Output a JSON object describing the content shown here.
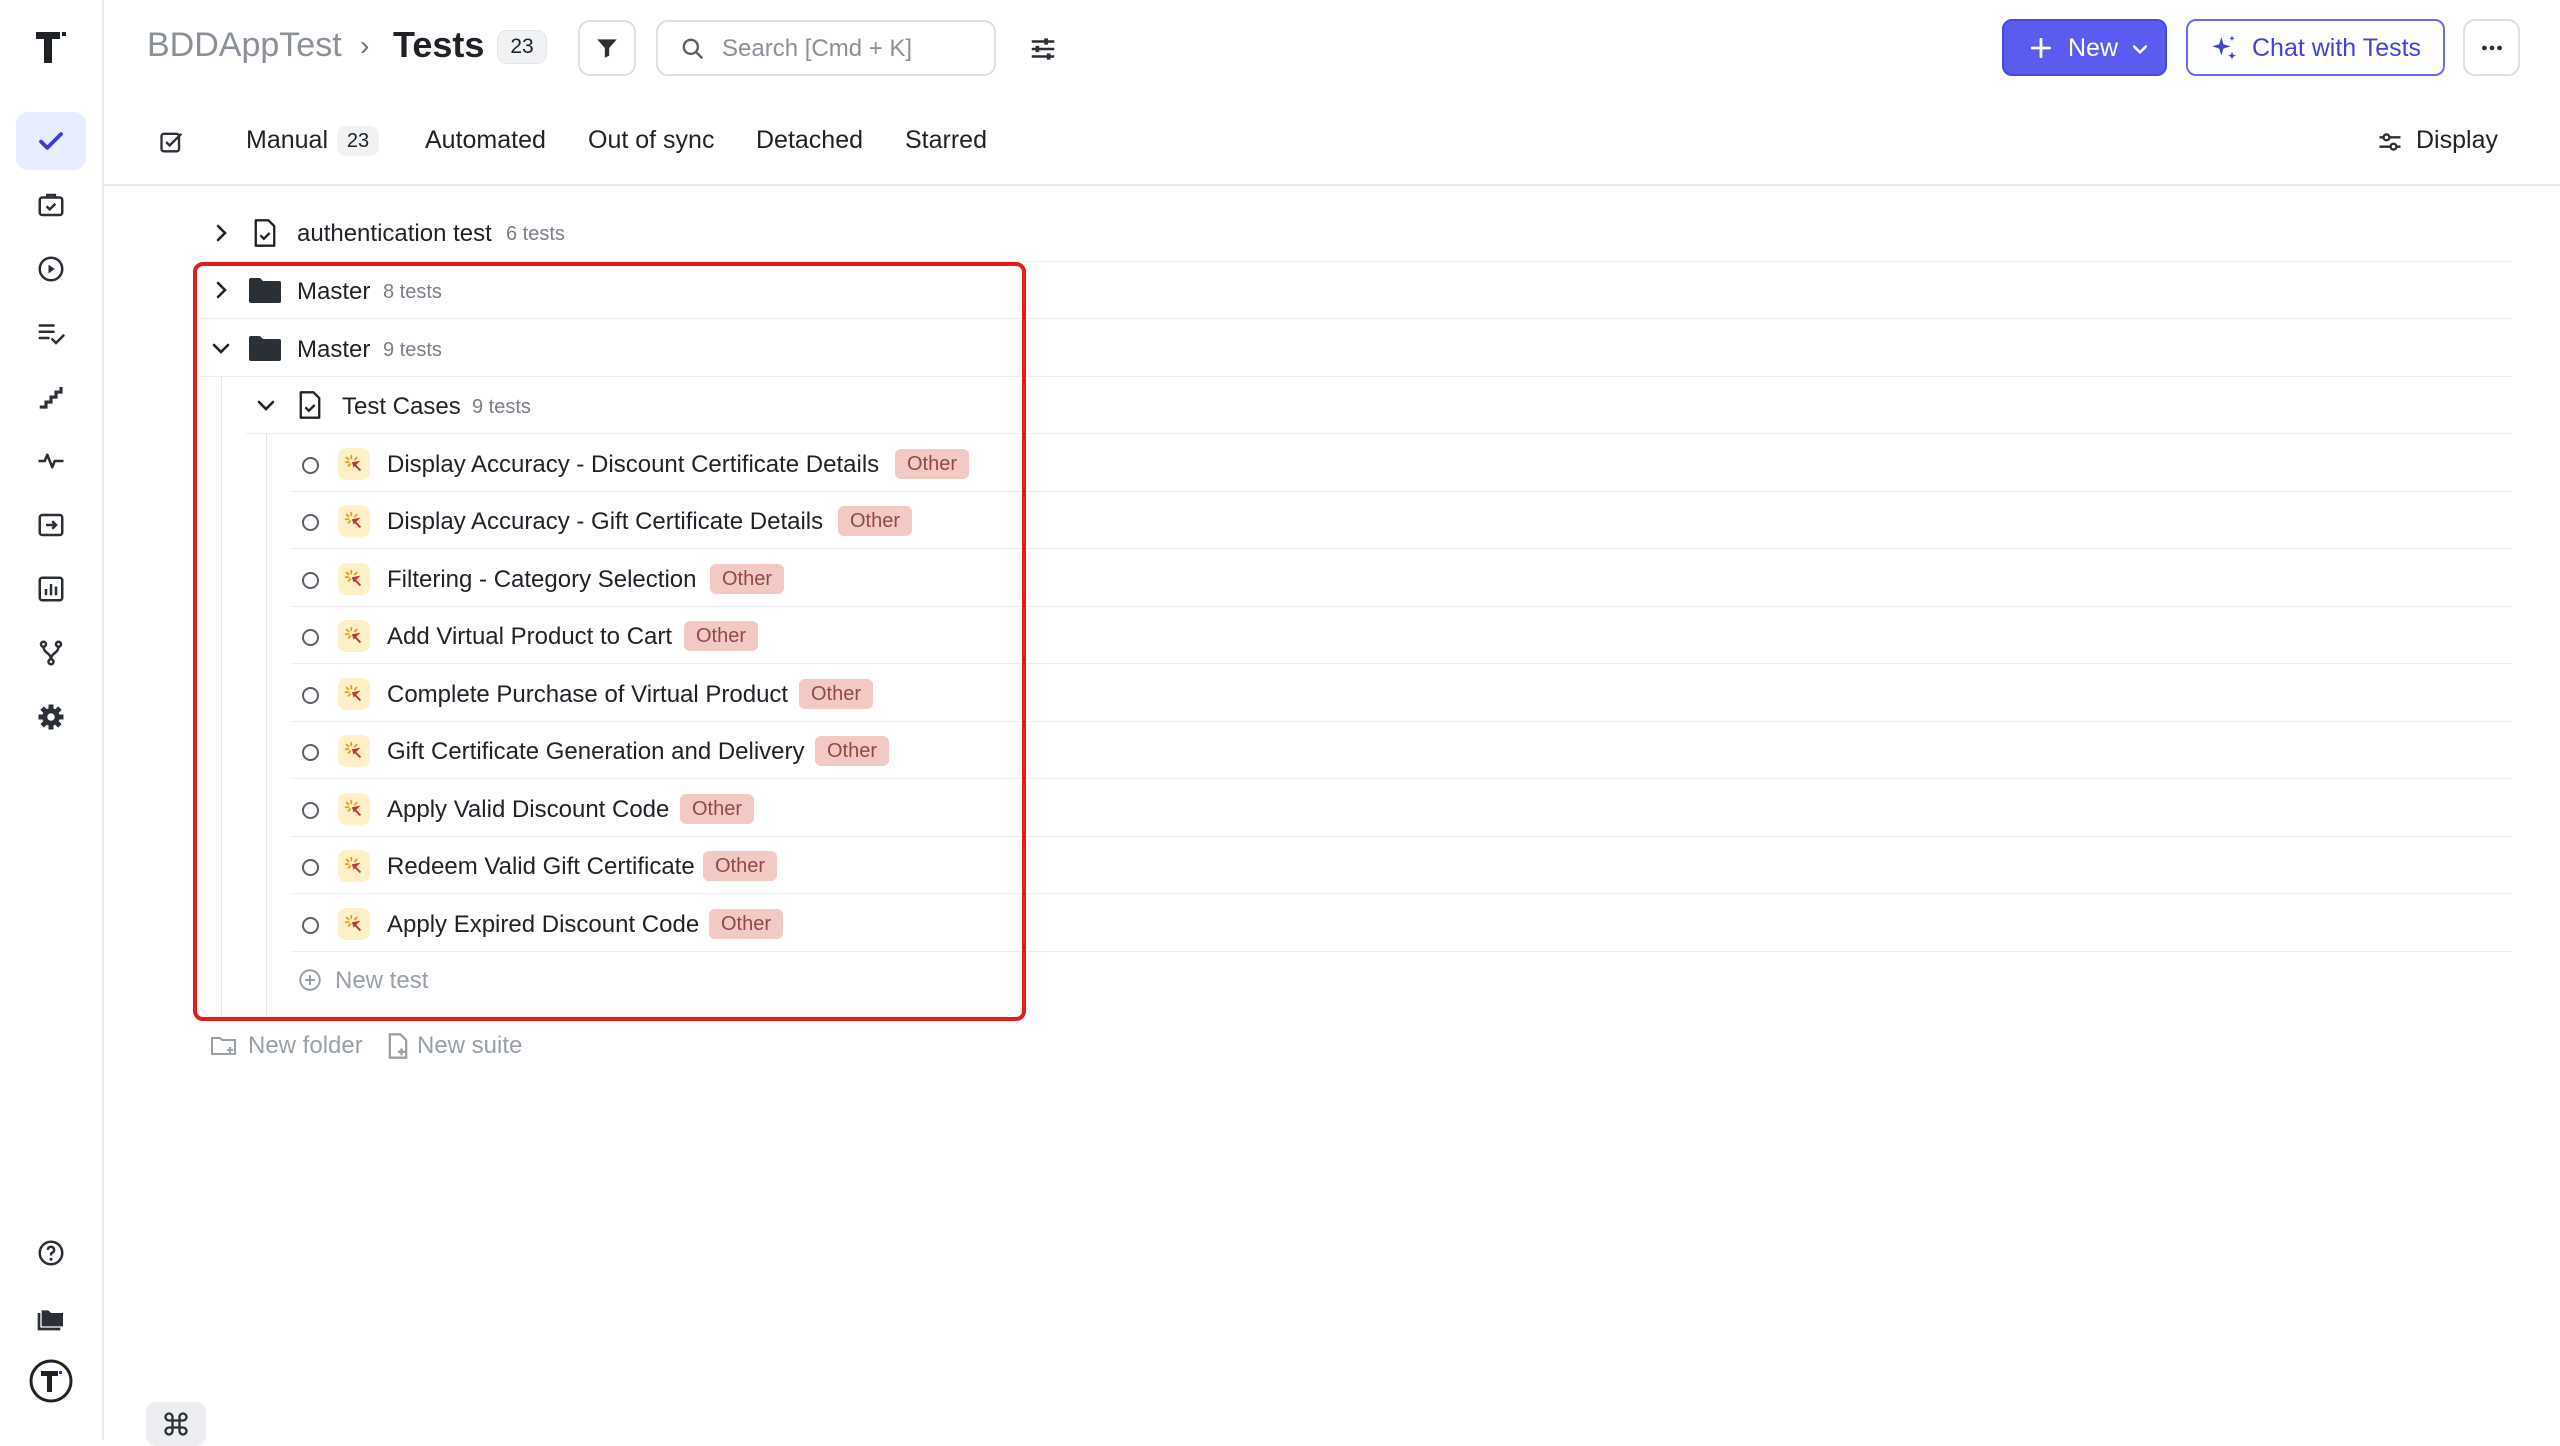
{
  "header": {
    "project": "BDDAppTest",
    "separator": "›",
    "title": "Tests",
    "count": "23",
    "search_placeholder": "Search [Cmd + K]",
    "new_label": "New",
    "chat_label": "Chat with Tests"
  },
  "tabs": [
    {
      "label": "Manual",
      "count": "23"
    },
    {
      "label": "Automated"
    },
    {
      "label": "Out of sync"
    },
    {
      "label": "Detached"
    },
    {
      "label": "Starred"
    }
  ],
  "display_label": "Display",
  "tree": {
    "suite_auth": {
      "name": "authentication test",
      "count": "6 tests"
    },
    "folder1": {
      "name": "Master",
      "count": "8 tests"
    },
    "folder2": {
      "name": "Master",
      "count": "9 tests"
    },
    "suite_cases": {
      "name": "Test Cases",
      "count": "9 tests"
    },
    "tests": [
      {
        "name": "Display Accuracy - Discount Certificate Details",
        "tag": "Other"
      },
      {
        "name": "Display Accuracy - Gift Certificate Details",
        "tag": "Other"
      },
      {
        "name": "Filtering - Category Selection",
        "tag": "Other"
      },
      {
        "name": "Add Virtual Product to Cart",
        "tag": "Other"
      },
      {
        "name": "Complete Purchase of Virtual Product",
        "tag": "Other"
      },
      {
        "name": "Gift Certificate Generation and Delivery",
        "tag": "Other"
      },
      {
        "name": "Apply Valid Discount Code",
        "tag": "Other"
      },
      {
        "name": "Redeem Valid Gift Certificate",
        "tag": "Other"
      },
      {
        "name": "Apply Expired Discount Code",
        "tag": "Other"
      }
    ],
    "new_test": "New test",
    "new_folder": "New folder",
    "new_suite": "New suite"
  },
  "colors": {
    "accent": "#5b5bf0",
    "tag_bg": "#f2c9c5",
    "tag_text": "#8f4a45",
    "highlight": "#e31b1b"
  },
  "icons": [
    "tests-icon",
    "briefcase-check-icon",
    "play-circle-icon",
    "list-check-icon",
    "stairs-icon",
    "activity-icon",
    "import-icon",
    "bar-chart-icon",
    "git-branch-icon",
    "gear-icon",
    "help-icon",
    "folders-icon",
    "avatar-logo-icon"
  ]
}
